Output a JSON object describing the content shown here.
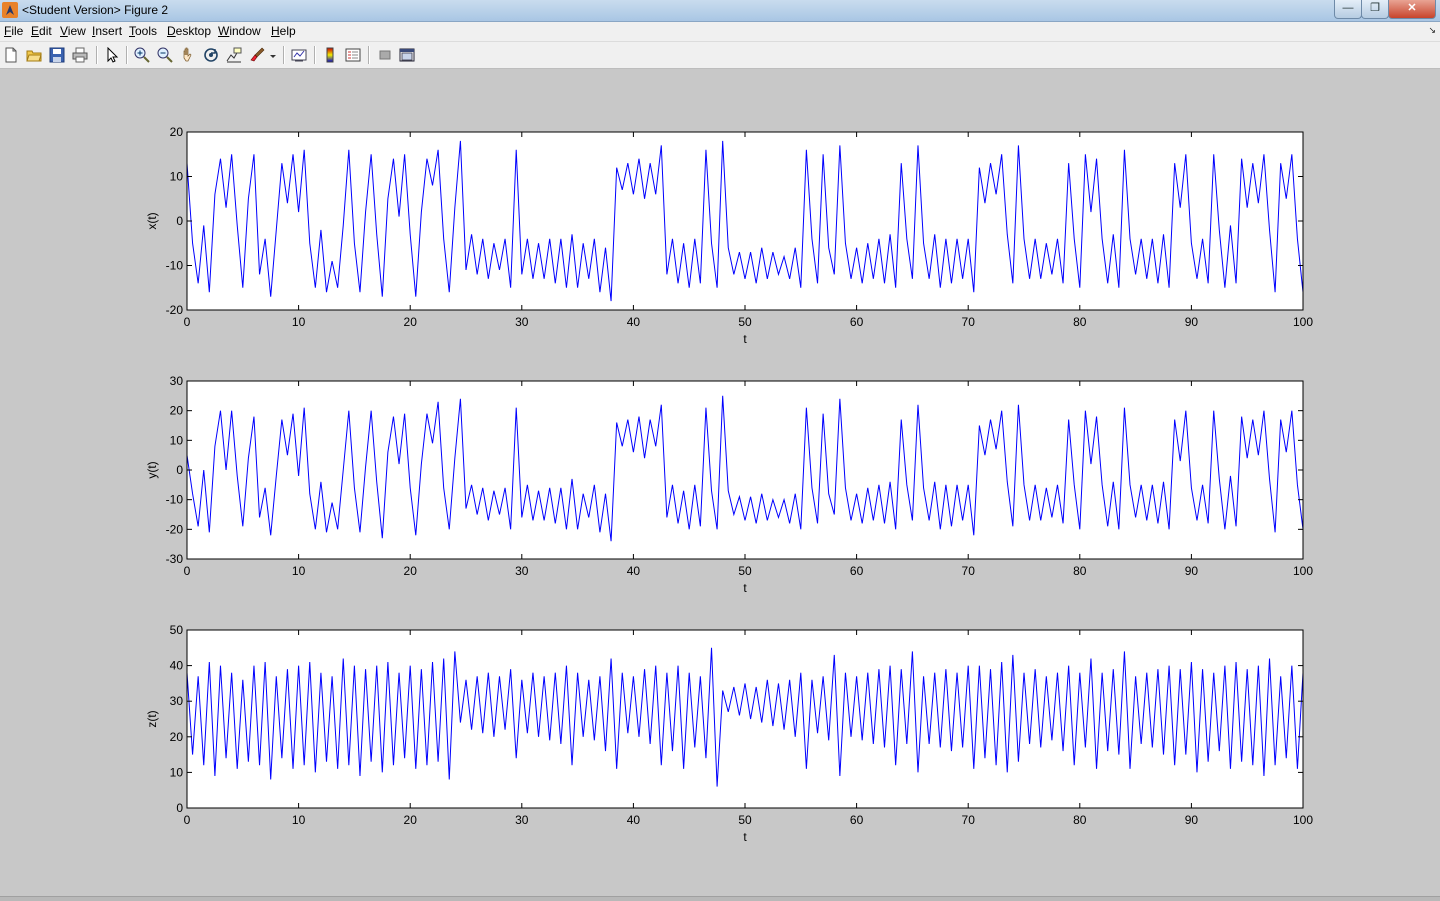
{
  "window": {
    "title": "<Student Version> Figure 2"
  },
  "menu": {
    "items": [
      "File",
      "Edit",
      "View",
      "Insert",
      "Tools",
      "Desktop",
      "Window",
      "Help"
    ]
  },
  "toolbar": {
    "icons": [
      "new-figure-icon",
      "open-file-icon",
      "save-icon",
      "print-icon",
      "edit-plot-arrow-icon",
      "zoom-in-icon",
      "zoom-out-icon",
      "pan-hand-icon",
      "rotate-3d-icon",
      "data-cursor-icon",
      "brush-icon",
      "link-plot-icon",
      "colorbar-icon",
      "legend-icon",
      "hide-plot-tools-icon",
      "show-plot-tools-icon"
    ]
  },
  "colors": {
    "line": "#0000ff",
    "axes_bg": "#ffffff",
    "figure_bg": "#c8c8c8"
  },
  "chart_data": [
    {
      "type": "line",
      "series_id": "x",
      "ylabel": "x(t)",
      "xlabel": "t",
      "xlim": [
        0,
        100
      ],
      "ylim": [
        -20,
        20
      ],
      "xticks": [
        "0",
        "10",
        "20",
        "30",
        "40",
        "50",
        "60",
        "70",
        "80",
        "90",
        "100"
      ],
      "yticks": [
        "20",
        "10",
        "0",
        "-10",
        "-20"
      ],
      "ytick_values": [
        20,
        10,
        0,
        -10,
        -20
      ],
      "grid": false,
      "x": [
        0,
        0.5,
        1,
        1.5,
        2,
        2.5,
        3,
        3.5,
        4,
        4.5,
        5,
        5.5,
        6,
        6.5,
        7,
        7.5,
        8,
        8.5,
        9,
        9.5,
        10,
        10.5,
        11,
        11.5,
        12,
        12.5,
        13,
        13.5,
        14,
        14.5,
        15,
        15.5,
        16,
        16.5,
        17,
        17.5,
        18,
        18.5,
        19,
        19.5,
        20,
        20.5,
        21,
        21.5,
        22,
        22.5,
        23,
        23.5,
        24,
        24.5,
        25,
        25.5,
        26,
        26.5,
        27,
        27.5,
        28,
        28.5,
        29,
        29.5,
        30,
        30.5,
        31,
        31.5,
        32,
        32.5,
        33,
        33.5,
        34,
        34.5,
        35,
        35.5,
        36,
        36.5,
        37,
        37.5,
        38,
        38.5,
        39,
        39.5,
        40,
        40.5,
        41,
        41.5,
        42,
        42.5,
        43,
        43.5,
        44,
        44.5,
        45,
        45.5,
        46,
        46.5,
        47,
        47.5,
        48,
        48.5,
        49,
        49.5,
        50,
        50.5,
        51,
        51.5,
        52,
        52.5,
        53,
        53.5,
        54,
        54.5,
        55,
        55.5,
        56,
        56.5,
        57,
        57.5,
        58,
        58.5,
        59,
        59.5,
        60,
        60.5,
        61,
        61.5,
        62,
        62.5,
        63,
        63.5,
        64,
        64.5,
        65,
        65.5,
        66,
        66.5,
        67,
        67.5,
        68,
        68.5,
        69,
        69.5,
        70,
        70.5,
        71,
        71.5,
        72,
        72.5,
        73,
        73.5,
        74,
        74.5,
        75,
        75.5,
        76,
        76.5,
        77,
        77.5,
        78,
        78.5,
        79,
        79.5,
        80,
        80.5,
        81,
        81.5,
        82,
        82.5,
        83,
        83.5,
        84,
        84.5,
        85,
        85.5,
        86,
        86.5,
        87,
        87.5,
        88,
        88.5,
        89,
        89.5,
        90,
        90.5,
        91,
        91.5,
        92,
        92.5,
        93,
        93.5,
        94,
        94.5,
        95,
        95.5,
        96,
        96.5,
        97,
        97.5,
        98,
        98.5,
        99,
        99.5,
        100
      ],
      "values": [
        13,
        -5,
        -14,
        -1,
        -16,
        6,
        14,
        3,
        15,
        -1,
        -15,
        5,
        15,
        -12,
        -4,
        -17,
        -2,
        13,
        4,
        15,
        2,
        16,
        -5,
        -15,
        -2,
        -16,
        -9,
        -15,
        -1,
        16,
        -5,
        -16,
        2,
        15,
        -3,
        -17,
        5,
        14,
        1,
        15,
        -3,
        -17,
        2,
        14,
        8,
        16,
        -4,
        -16,
        3,
        18,
        -11,
        -3,
        -12,
        -4,
        -13,
        -5,
        -11,
        -4,
        -15,
        16,
        -12,
        -4,
        -13,
        -5,
        -13,
        -4,
        -14,
        -4,
        -15,
        -3,
        -15,
        -5,
        -13,
        -4,
        -16,
        -6,
        -18,
        12,
        7,
        13,
        6,
        14,
        5,
        13,
        6,
        17,
        -12,
        -4,
        -14,
        -5,
        -15,
        -4,
        -14,
        16,
        -5,
        -15,
        18,
        -6,
        -12,
        -7,
        -13,
        -7,
        -14,
        -6,
        -13,
        -7,
        -12,
        -8,
        -13,
        -6,
        -15,
        16,
        -4,
        -14,
        15,
        -6,
        -12,
        17,
        -5,
        -13,
        -6,
        -14,
        -5,
        -13,
        -4,
        -14,
        -3,
        -15,
        13,
        -4,
        -13,
        17,
        -5,
        -13,
        -3,
        -15,
        -4,
        -14,
        -4,
        -13,
        -4,
        -16,
        12,
        4,
        13,
        6,
        15,
        -3,
        -14,
        17,
        -4,
        -13,
        -4,
        -13,
        -5,
        -12,
        -4,
        -14,
        13,
        -4,
        -15,
        15,
        2,
        14,
        -4,
        -14,
        -3,
        -15,
        16,
        -4,
        -12,
        -4,
        -13,
        -4,
        -14,
        -3,
        -15,
        13,
        3,
        15,
        -5,
        -13,
        -4,
        -14,
        15,
        -2,
        -15,
        -1,
        -14,
        14,
        3,
        13,
        4,
        15,
        -2,
        -16,
        13,
        5,
        15,
        -4,
        -16,
        0
      ]
    },
    {
      "type": "line",
      "series_id": "y",
      "ylabel": "y(t)",
      "xlabel": "t",
      "xlim": [
        0,
        100
      ],
      "ylim": [
        -30,
        30
      ],
      "xticks": [
        "0",
        "10",
        "20",
        "30",
        "40",
        "50",
        "60",
        "70",
        "80",
        "90",
        "100"
      ],
      "yticks": [
        "30",
        "20",
        "10",
        "0",
        "-10",
        "-20",
        "-30"
      ],
      "ytick_values": [
        30,
        20,
        10,
        0,
        -10,
        -20,
        -30
      ],
      "grid": false,
      "x": [
        0,
        0.5,
        1,
        1.5,
        2,
        2.5,
        3,
        3.5,
        4,
        4.5,
        5,
        5.5,
        6,
        6.5,
        7,
        7.5,
        8,
        8.5,
        9,
        9.5,
        10,
        10.5,
        11,
        11.5,
        12,
        12.5,
        13,
        13.5,
        14,
        14.5,
        15,
        15.5,
        16,
        16.5,
        17,
        17.5,
        18,
        18.5,
        19,
        19.5,
        20,
        20.5,
        21,
        21.5,
        22,
        22.5,
        23,
        23.5,
        24,
        24.5,
        25,
        25.5,
        26,
        26.5,
        27,
        27.5,
        28,
        28.5,
        29,
        29.5,
        30,
        30.5,
        31,
        31.5,
        32,
        32.5,
        33,
        33.5,
        34,
        34.5,
        35,
        35.5,
        36,
        36.5,
        37,
        37.5,
        38,
        38.5,
        39,
        39.5,
        40,
        40.5,
        41,
        41.5,
        42,
        42.5,
        43,
        43.5,
        44,
        44.5,
        45,
        45.5,
        46,
        46.5,
        47,
        47.5,
        48,
        48.5,
        49,
        49.5,
        50,
        50.5,
        51,
        51.5,
        52,
        52.5,
        53,
        53.5,
        54,
        54.5,
        55,
        55.5,
        56,
        56.5,
        57,
        57.5,
        58,
        58.5,
        59,
        59.5,
        60,
        60.5,
        61,
        61.5,
        62,
        62.5,
        63,
        63.5,
        64,
        64.5,
        65,
        65.5,
        66,
        66.5,
        67,
        67.5,
        68,
        68.5,
        69,
        69.5,
        70,
        70.5,
        71,
        71.5,
        72,
        72.5,
        73,
        73.5,
        74,
        74.5,
        75,
        75.5,
        76,
        76.5,
        77,
        77.5,
        78,
        78.5,
        79,
        79.5,
        80,
        80.5,
        81,
        81.5,
        82,
        82.5,
        83,
        83.5,
        84,
        84.5,
        85,
        85.5,
        86,
        86.5,
        87,
        87.5,
        88,
        88.5,
        89,
        89.5,
        90,
        90.5,
        91,
        91.5,
        92,
        92.5,
        93,
        93.5,
        94,
        94.5,
        95,
        95.5,
        96,
        96.5,
        97,
        97.5,
        98,
        98.5,
        99,
        99.5,
        100
      ],
      "values": [
        5,
        -8,
        -19,
        0,
        -21,
        8,
        20,
        0,
        20,
        -2,
        -19,
        4,
        18,
        -16,
        -6,
        -22,
        -2,
        17,
        5,
        19,
        -2,
        21,
        -8,
        -20,
        -4,
        -21,
        -11,
        -20,
        0,
        20,
        -6,
        -21,
        1,
        20,
        -4,
        -23,
        6,
        18,
        2,
        19,
        -6,
        -22,
        2,
        19,
        9,
        23,
        -6,
        -20,
        4,
        24,
        -13,
        -5,
        -15,
        -6,
        -17,
        -7,
        -15,
        -6,
        -20,
        21,
        -16,
        -5,
        -17,
        -7,
        -17,
        -6,
        -18,
        -6,
        -20,
        -3,
        -20,
        -8,
        -16,
        -5,
        -21,
        -8,
        -24,
        16,
        8,
        17,
        6,
        18,
        4,
        17,
        8,
        22,
        -16,
        -5,
        -18,
        -7,
        -20,
        -5,
        -19,
        21,
        -7,
        -20,
        25,
        -7,
        -15,
        -9,
        -17,
        -9,
        -18,
        -8,
        -17,
        -10,
        -16,
        -10,
        -18,
        -8,
        -20,
        21,
        -6,
        -18,
        19,
        -8,
        -15,
        24,
        -6,
        -17,
        -8,
        -18,
        -6,
        -17,
        -5,
        -18,
        -4,
        -20,
        17,
        -5,
        -17,
        22,
        -6,
        -17,
        -4,
        -20,
        -5,
        -19,
        -5,
        -17,
        -5,
        -22,
        15,
        5,
        17,
        7,
        20,
        -4,
        -19,
        22,
        -5,
        -17,
        -5,
        -17,
        -6,
        -16,
        -5,
        -18,
        17,
        -5,
        -20,
        20,
        2,
        18,
        -5,
        -19,
        -4,
        -20,
        21,
        -5,
        -16,
        -5,
        -17,
        -5,
        -18,
        -4,
        -20,
        17,
        3,
        20,
        -6,
        -17,
        -5,
        -18,
        20,
        -3,
        -20,
        -2,
        -19,
        18,
        4,
        17,
        5,
        20,
        -3,
        -21,
        17,
        6,
        20,
        -5,
        -20,
        2
      ]
    },
    {
      "type": "line",
      "series_id": "z",
      "ylabel": "z(t)",
      "xlabel": "t",
      "xlim": [
        0,
        100
      ],
      "ylim": [
        0,
        50
      ],
      "xticks": [
        "0",
        "10",
        "20",
        "30",
        "40",
        "50",
        "60",
        "70",
        "80",
        "90",
        "100"
      ],
      "yticks": [
        "50",
        "40",
        "30",
        "20",
        "10",
        "0"
      ],
      "ytick_values": [
        50,
        40,
        30,
        20,
        10,
        0
      ],
      "grid": false,
      "x": [
        0,
        0.5,
        1,
        1.5,
        2,
        2.5,
        3,
        3.5,
        4,
        4.5,
        5,
        5.5,
        6,
        6.5,
        7,
        7.5,
        8,
        8.5,
        9,
        9.5,
        10,
        10.5,
        11,
        11.5,
        12,
        12.5,
        13,
        13.5,
        14,
        14.5,
        15,
        15.5,
        16,
        16.5,
        17,
        17.5,
        18,
        18.5,
        19,
        19.5,
        20,
        20.5,
        21,
        21.5,
        22,
        22.5,
        23,
        23.5,
        24,
        24.5,
        25,
        25.5,
        26,
        26.5,
        27,
        27.5,
        28,
        28.5,
        29,
        29.5,
        30,
        30.5,
        31,
        31.5,
        32,
        32.5,
        33,
        33.5,
        34,
        34.5,
        35,
        35.5,
        36,
        36.5,
        37,
        37.5,
        38,
        38.5,
        39,
        39.5,
        40,
        40.5,
        41,
        41.5,
        42,
        42.5,
        43,
        43.5,
        44,
        44.5,
        45,
        45.5,
        46,
        46.5,
        47,
        47.5,
        48,
        48.5,
        49,
        49.5,
        50,
        50.5,
        51,
        51.5,
        52,
        52.5,
        53,
        53.5,
        54,
        54.5,
        55,
        55.5,
        56,
        56.5,
        57,
        57.5,
        58,
        58.5,
        59,
        59.5,
        60,
        60.5,
        61,
        61.5,
        62,
        62.5,
        63,
        63.5,
        64,
        64.5,
        65,
        65.5,
        66,
        66.5,
        67,
        67.5,
        68,
        68.5,
        69,
        69.5,
        70,
        70.5,
        71,
        71.5,
        72,
        72.5,
        73,
        73.5,
        74,
        74.5,
        75,
        75.5,
        76,
        76.5,
        77,
        77.5,
        78,
        78.5,
        79,
        79.5,
        80,
        80.5,
        81,
        81.5,
        82,
        82.5,
        83,
        83.5,
        84,
        84.5,
        85,
        85.5,
        86,
        86.5,
        87,
        87.5,
        88,
        88.5,
        89,
        89.5,
        90,
        90.5,
        91,
        91.5,
        92,
        92.5,
        93,
        93.5,
        94,
        94.5,
        95,
        95.5,
        96,
        96.5,
        97,
        97.5,
        98,
        98.5,
        99,
        99.5,
        100
      ],
      "values": [
        38,
        15,
        37,
        12,
        41,
        9,
        40,
        14,
        38,
        11,
        36,
        13,
        40,
        12,
        41,
        8,
        37,
        14,
        39,
        11,
        40,
        12,
        41,
        10,
        38,
        13,
        37,
        11,
        42,
        12,
        40,
        9,
        39,
        13,
        40,
        10,
        41,
        12,
        38,
        14,
        40,
        11,
        39,
        12,
        41,
        13,
        42,
        8,
        44,
        24,
        36,
        22,
        37,
        21,
        38,
        20,
        37,
        22,
        39,
        14,
        36,
        21,
        38,
        20,
        37,
        19,
        38,
        18,
        40,
        12,
        38,
        20,
        36,
        19,
        37,
        16,
        42,
        11,
        38,
        21,
        37,
        20,
        39,
        18,
        40,
        12,
        38,
        16,
        40,
        11,
        38,
        17,
        37,
        14,
        45,
        6,
        33,
        27,
        34,
        26,
        35,
        25,
        34,
        24,
        36,
        23,
        35,
        22,
        36,
        20,
        38,
        11,
        36,
        21,
        37,
        19,
        43,
        9,
        38,
        20,
        37,
        19,
        38,
        18,
        39,
        17,
        40,
        12,
        39,
        18,
        44,
        10,
        37,
        18,
        38,
        17,
        39,
        16,
        38,
        17,
        40,
        11,
        40,
        14,
        39,
        12,
        41,
        10,
        43,
        13,
        38,
        18,
        39,
        17,
        37,
        19,
        38,
        16,
        40,
        12,
        38,
        17,
        42,
        11,
        38,
        16,
        39,
        15,
        44,
        11,
        37,
        18,
        38,
        17,
        39,
        15,
        40,
        12,
        39,
        15,
        41,
        10,
        39,
        13,
        38,
        16,
        40,
        11,
        41,
        13,
        39,
        12,
        40,
        9,
        42,
        12,
        37,
        14,
        40,
        11,
        38,
        20
      ]
    }
  ]
}
